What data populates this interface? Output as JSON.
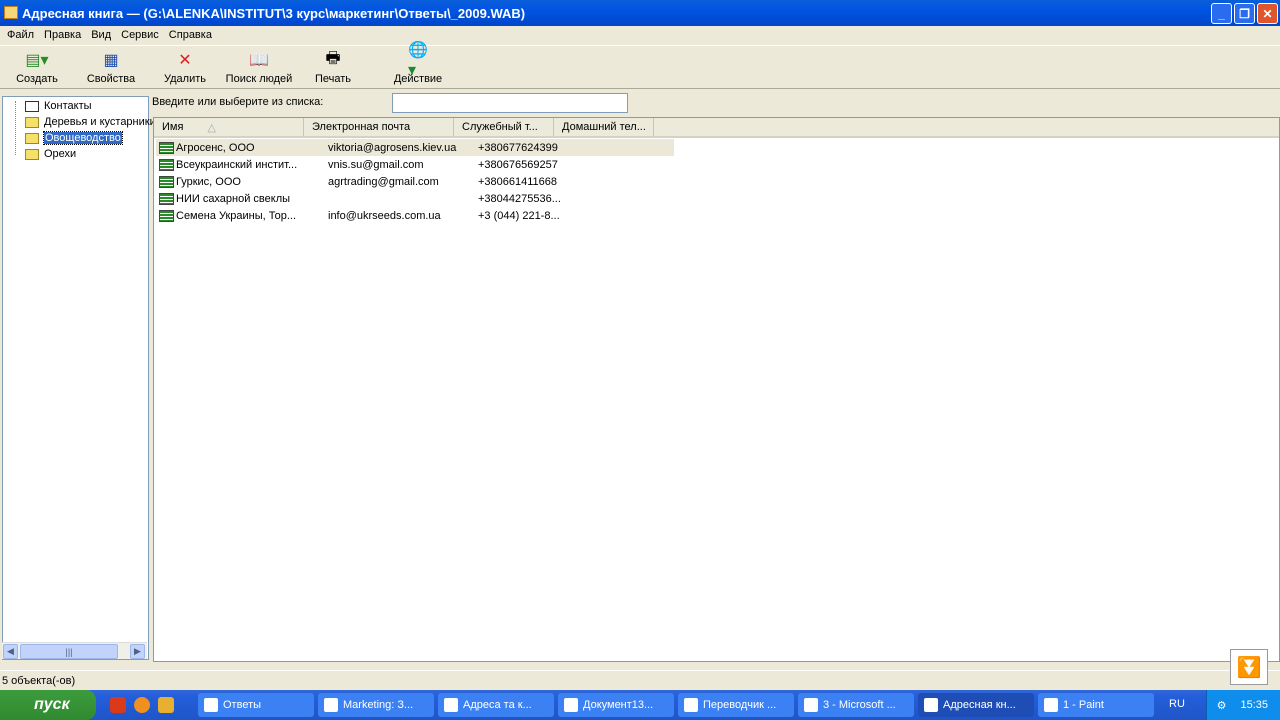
{
  "window": {
    "title": "Адресная книга — (G:\\ALENKA\\INSTITUT\\3 курс\\маркетинг\\Ответы\\_2009.WAB)"
  },
  "menu": [
    "Файл",
    "Правка",
    "Вид",
    "Сервис",
    "Справка"
  ],
  "toolbar": [
    {
      "label": "Создать",
      "icon": "new-contact-icon"
    },
    {
      "label": "Свойства",
      "icon": "properties-icon"
    },
    {
      "label": "Удалить",
      "icon": "delete-icon"
    },
    {
      "label": "Поиск людей",
      "icon": "find-people-icon"
    },
    {
      "label": "Печать",
      "icon": "print-icon"
    },
    {
      "label": "Действие",
      "icon": "action-icon"
    }
  ],
  "tree": [
    {
      "label": "Контакты"
    },
    {
      "label": "Деревья и кустарники"
    },
    {
      "label": "Овощеводство",
      "selected": true
    },
    {
      "label": "Орехи"
    }
  ],
  "search": {
    "label": "Введите или выберите из списка:",
    "value": ""
  },
  "list": {
    "columns": [
      "Имя",
      "Электронная почта",
      "Служебный т...",
      "Домашний тел..."
    ],
    "rows": [
      [
        "Агросенс, ООО",
        "viktoria@agrosens.kiev.ua",
        "+380677624399",
        ""
      ],
      [
        "Всеукраинский инстит...",
        "vnis.su@gmail.com",
        "+380676569257",
        ""
      ],
      [
        "Гуркис, ООО",
        "agrtrading@gmail.com",
        "+380661411668",
        ""
      ],
      [
        "НИИ сахарной свеклы",
        "",
        "+38044275536...",
        ""
      ],
      [
        "Семена Украины, Тор...",
        "info@ukrseeds.com.ua",
        "+3 (044) 221-8...",
        ""
      ]
    ]
  },
  "status": "5 объекта(-ов)",
  "taskbar": {
    "start": "пуск",
    "tasks": [
      "Ответы",
      "Marketing: З...",
      "Адреса та к...",
      "Документ13...",
      "Переводчик ...",
      "3 - Microsoft ...",
      "Адресная кн...",
      "1 - Paint"
    ],
    "lang": "RU",
    "clock": "15:35"
  }
}
